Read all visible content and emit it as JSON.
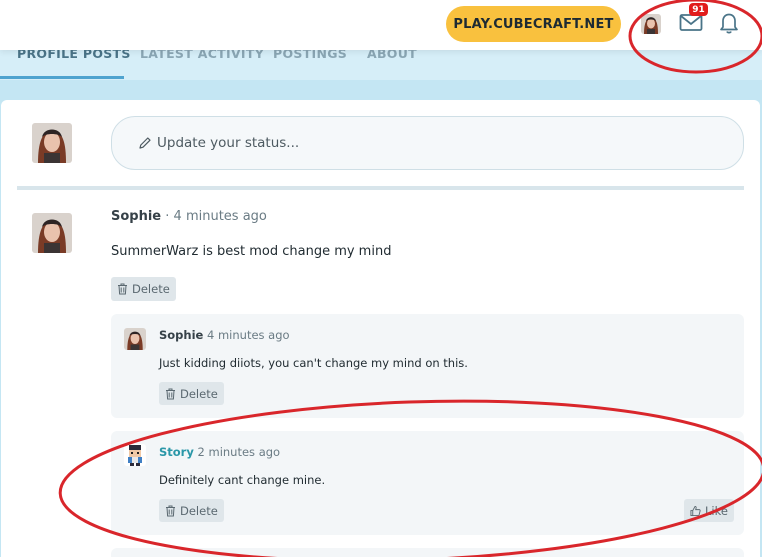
{
  "header": {
    "play_button": "PLAY.CUBECRAFT.NET",
    "mail_badge": "91"
  },
  "tabs": [
    {
      "label": "PROFILE POSTS"
    },
    {
      "label": "LATEST ACTIVITY"
    },
    {
      "label": "POSTINGS"
    },
    {
      "label": "ABOUT"
    }
  ],
  "status": {
    "placeholder": "Update your status..."
  },
  "post": {
    "author": "Sophie",
    "separator": " · ",
    "time": "4 minutes ago",
    "text": "SummerWarz is best mod change my mind",
    "delete_label": "Delete"
  },
  "comments": [
    {
      "author": "Sophie",
      "time": "4 minutes ago",
      "text": "Just kidding diiots, you can't change my mind on this.",
      "delete_label": "Delete"
    },
    {
      "author": "Story",
      "time": "2 minutes ago",
      "text": "Definitely cant change mine.",
      "delete_label": "Delete",
      "like_label": "Like"
    }
  ],
  "colors": {
    "accent": "#4fa3cf",
    "play_button": "#f9c13e",
    "badge": "#e11c1c",
    "annotation": "#d9262b"
  }
}
